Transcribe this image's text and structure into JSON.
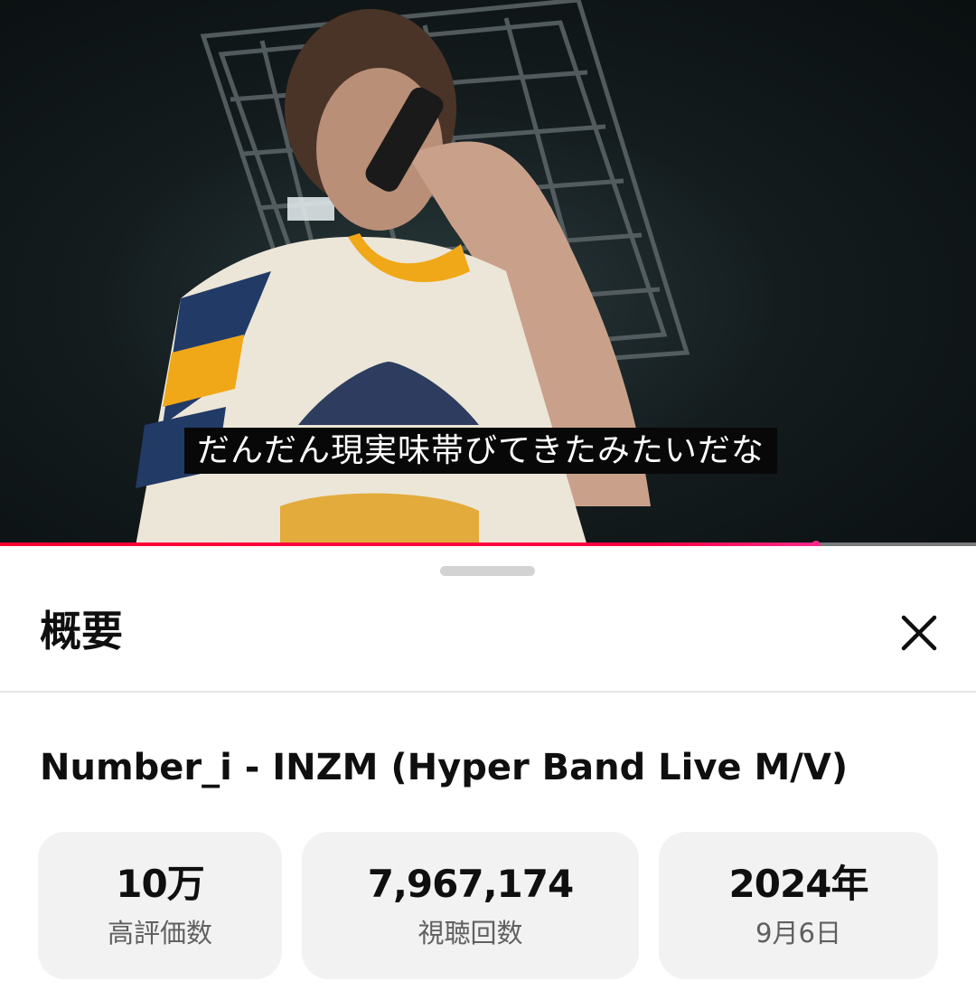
{
  "player": {
    "subtitle": "だんだん現実味帯びてきたみたいだな",
    "progress_fraction": 0.836
  },
  "panel": {
    "title": "概要",
    "close_icon": "close-icon"
  },
  "video": {
    "title": "Number_i - INZM (Hyper Band Live M/V)"
  },
  "stats": [
    {
      "value": "10万",
      "label": "高評価数"
    },
    {
      "value": "7,967,174",
      "label": "視聴回数"
    },
    {
      "value": "2024年",
      "label": "9月6日"
    }
  ],
  "colors": {
    "progress_red": "#ff0033",
    "progress_pink": "#ff2a8a",
    "stat_background": "#f2f2f2",
    "secondary_text": "#606060"
  }
}
